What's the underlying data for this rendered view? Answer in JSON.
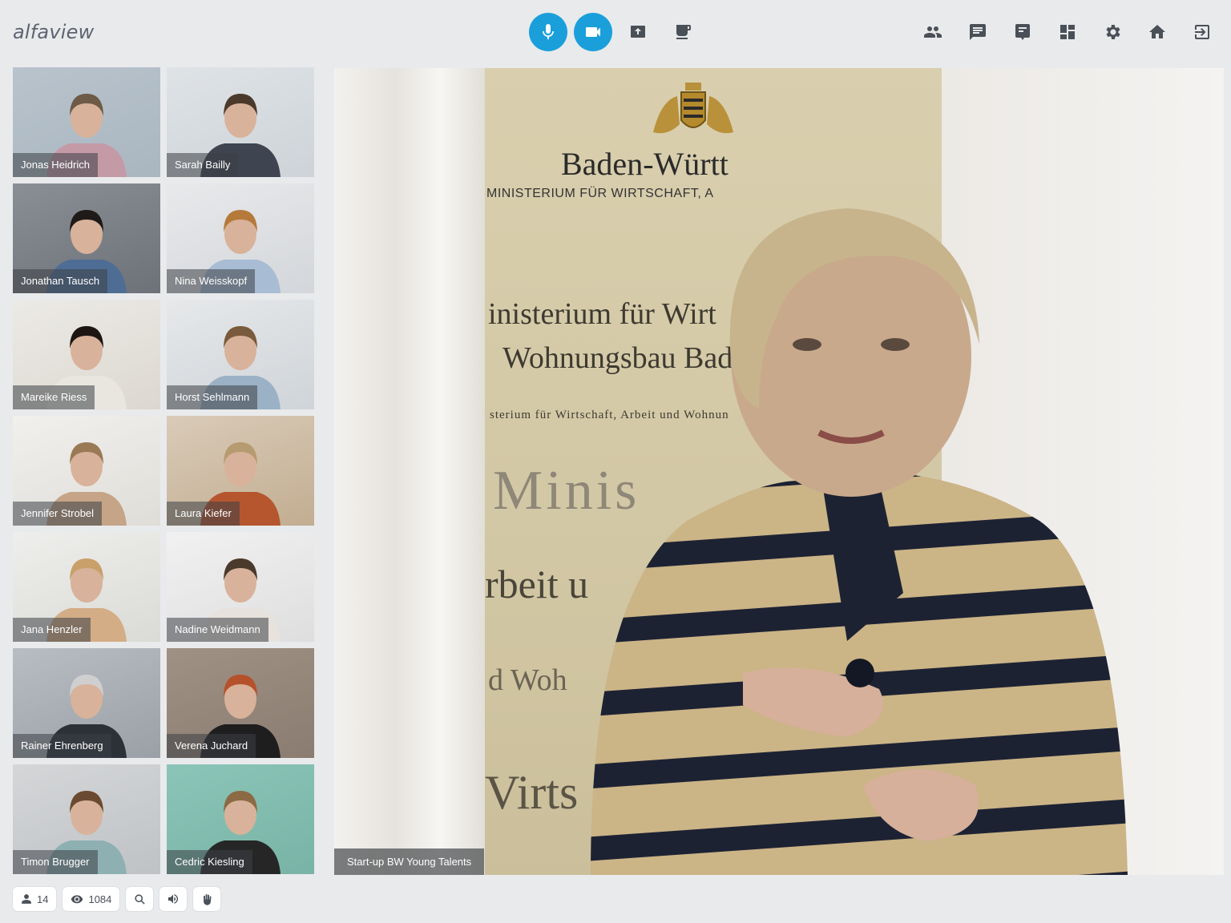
{
  "app": {
    "logo_text": "alfaview"
  },
  "colors": {
    "accent": "#1a9fdb",
    "icon": "#4a5058",
    "background": "#e9eaec"
  },
  "toolbar_center": [
    {
      "icon": "microphone-icon",
      "active": true
    },
    {
      "icon": "video-camera-icon",
      "active": true
    },
    {
      "icon": "screen-share-icon",
      "active": false
    },
    {
      "icon": "coffee-break-icon",
      "active": false
    }
  ],
  "toolbar_right": [
    {
      "icon": "participants-icon"
    },
    {
      "icon": "chat-icon"
    },
    {
      "icon": "whiteboard-icon"
    },
    {
      "icon": "layout-grid-icon"
    },
    {
      "icon": "settings-gear-icon"
    },
    {
      "icon": "home-icon"
    },
    {
      "icon": "exit-icon"
    }
  ],
  "participants": [
    {
      "name": "Jonas Heidrich"
    },
    {
      "name": "Sarah Bailly"
    },
    {
      "name": "Jonathan Tausch"
    },
    {
      "name": "Nina Weisskopf"
    },
    {
      "name": "Mareike Riess"
    },
    {
      "name": "Horst Sehlmann"
    },
    {
      "name": "Jennifer Strobel"
    },
    {
      "name": "Laura Kiefer"
    },
    {
      "name": "Jana Henzler"
    },
    {
      "name": "Nadine Weidmann"
    },
    {
      "name": "Rainer Ehrenberg"
    },
    {
      "name": "Verena Juchard"
    },
    {
      "name": "Timon Brugger"
    },
    {
      "name": "Cedric Kiesling"
    }
  ],
  "main_video": {
    "label": "Start-up BW Young Talents",
    "banner": {
      "title": "Baden-Württ",
      "subtitle": "MINISTERIUM FÜR WIRTSCHAFT, A",
      "line1": "inisterium für Wirt",
      "line2": "Wohnungsbau Bad",
      "line3": "sterium für Wirtschaft, Arbeit und Wohnun",
      "line4": "Minis",
      "line5": "rbeit u",
      "line6": "d Woh",
      "line7": "Virts"
    }
  },
  "bottom_bar": {
    "participant_count": "14",
    "viewer_count": "1084"
  }
}
